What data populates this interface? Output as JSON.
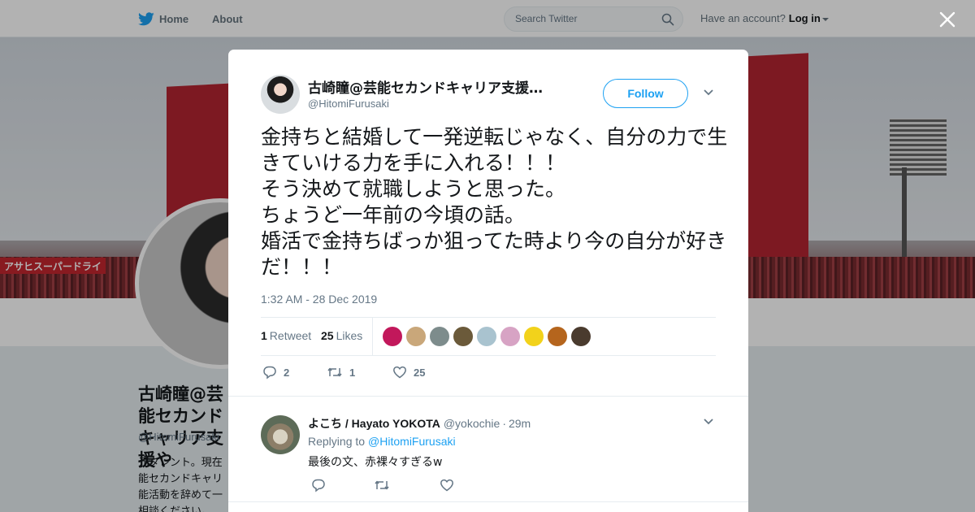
{
  "nav": {
    "home_label": "Home",
    "about_label": "About",
    "search_placeholder": "Search Twitter",
    "have_account": "Have an account?",
    "login_label": "Log in"
  },
  "banner": {
    "sign_text": "アサヒスーパードライ"
  },
  "profile": {
    "name": "古崎瞳@芸能セカンドキャリア支援や",
    "handle": "@HitomiFurusaki",
    "bio": "元タレント。現在\n能セカンドキャリ\n能活動を辞めて一\n相談ください。"
  },
  "tweet": {
    "author_name": "古崎瞳@芸能セカンドキャリア支援…",
    "author_handle": "@HitomiFurusaki",
    "follow_label": "Follow",
    "text": "金持ちと結婚して一発逆転じゃなく、自分の力で生きていける力を手に入れる！！！\nそう決めて就職しようと思った。\nちょうど一年前の今頃の話。\n婚活で金持ちばっか狙ってた時より今の自分が好きだ！！！",
    "timestamp": "1:32 AM - 28 Dec 2019",
    "retweet_count": "1",
    "retweet_label": "Retweet",
    "like_count": "25",
    "like_label": "Likes",
    "likers": [
      {
        "name": "liker-1",
        "color": "#c2185b"
      },
      {
        "name": "liker-2",
        "color": "#c9a77a"
      },
      {
        "name": "liker-3",
        "color": "#7d8c8c"
      },
      {
        "name": "liker-4",
        "color": "#6b5a3a"
      },
      {
        "name": "liker-5",
        "color": "#a9c3cf"
      },
      {
        "name": "liker-6",
        "color": "#d7a3c4"
      },
      {
        "name": "liker-7",
        "color": "#f2d21b"
      },
      {
        "name": "liker-8",
        "color": "#b5651d"
      },
      {
        "name": "liker-9",
        "color": "#4a3b2e"
      }
    ],
    "actions": {
      "reply_count": "2",
      "retweet_count": "1",
      "like_count": "25"
    }
  },
  "reply": {
    "name": "よこち / Hayato YOKOTA",
    "handle": "@yokochie",
    "separator": "·",
    "time": "29m",
    "replying_to_label": "Replying to",
    "replying_to_handle": "@HitomiFurusaki",
    "text": "最後の文、赤裸々すぎるw"
  },
  "colors": {
    "accent": "#1da1f2",
    "text_secondary": "#657786"
  }
}
